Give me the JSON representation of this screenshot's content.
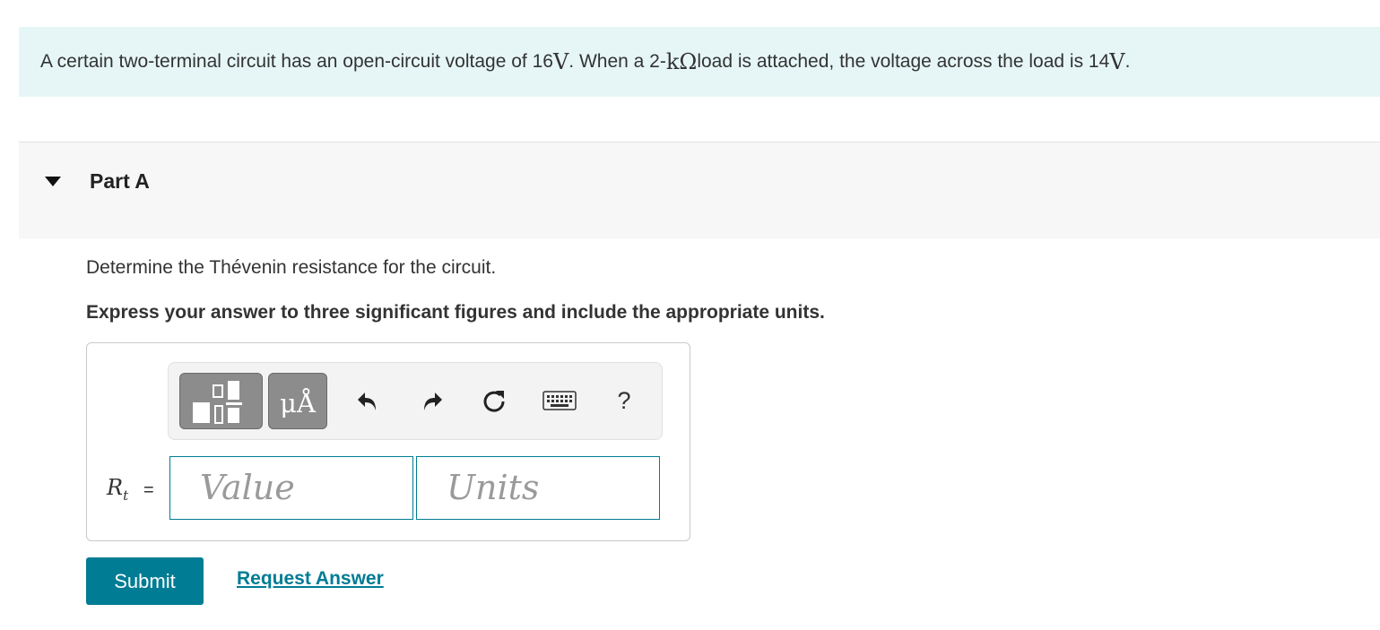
{
  "problem": {
    "text_part1": "A certain two-terminal circuit has an open-circuit voltage of 16 ",
    "unit_v1": "V",
    "text_part2": ". When a 2-",
    "unit_kohm": "kΩ",
    "text_part3": " load is attached, the voltage across the load is 14 ",
    "unit_v2": "V",
    "text_part4": "."
  },
  "part": {
    "title": "Part A"
  },
  "question": {
    "text": "Determine the Thévenin resistance for the circuit.",
    "instruction": "Express your answer to three significant figures and include the appropriate units."
  },
  "answer": {
    "label_symbol": "R",
    "label_subscript": "t",
    "label_equals": "=",
    "value_placeholder": "Value",
    "units_placeholder": "Units"
  },
  "toolbar": {
    "units_button_label": "μÅ",
    "help_label": "?",
    "icons": [
      "templates-icon",
      "units-icon",
      "undo-icon",
      "redo-icon",
      "reset-icon",
      "keyboard-icon",
      "help-icon"
    ]
  },
  "actions": {
    "submit_label": "Submit",
    "request_answer_label": "Request Answer"
  },
  "colors": {
    "banner_bg": "#e6f6f7",
    "accent": "#007c94",
    "toolbar_button": "#8c8c8c"
  }
}
